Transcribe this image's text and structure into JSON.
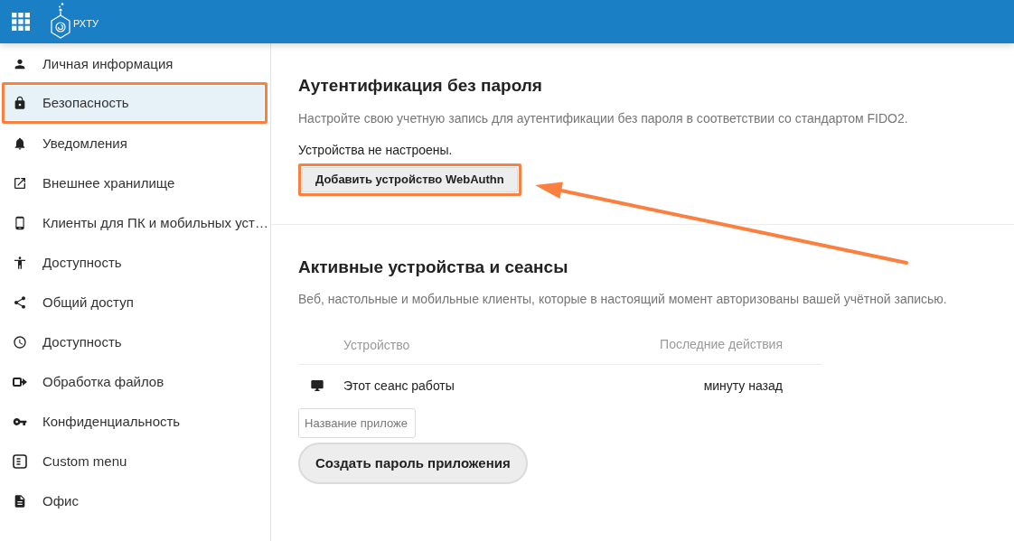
{
  "header": {
    "logo_text": "РХТУ"
  },
  "sidebar": {
    "items": [
      {
        "label": "Личная информация",
        "selected": false,
        "highlighted": false
      },
      {
        "label": "Безопасность",
        "selected": true,
        "highlighted": true
      },
      {
        "label": "Уведомления",
        "selected": false,
        "highlighted": false
      },
      {
        "label": "Внешнее хранилище",
        "selected": false,
        "highlighted": false
      },
      {
        "label": "Клиенты для ПК и мобильных уст…",
        "selected": false,
        "highlighted": false
      },
      {
        "label": "Доступность",
        "selected": false,
        "highlighted": false
      },
      {
        "label": "Общий доступ",
        "selected": false,
        "highlighted": false
      },
      {
        "label": "Доступность",
        "selected": false,
        "highlighted": false
      },
      {
        "label": "Обработка файлов",
        "selected": false,
        "highlighted": false
      },
      {
        "label": "Конфиденциальность",
        "selected": false,
        "highlighted": false
      },
      {
        "label": "Custom menu",
        "selected": false,
        "highlighted": false
      },
      {
        "label": "Офис",
        "selected": false,
        "highlighted": false
      }
    ]
  },
  "passwordless": {
    "title": "Аутентификация без пароля",
    "description": "Настройте свою учетную запись для аутентификации без пароля в соответствии со стандартом FIDO2.",
    "status": "Устройства не настроены.",
    "add_button": {
      "label": "Добавить устройство WebAuthn",
      "highlighted": true
    }
  },
  "sessions": {
    "title": "Активные устройства и сеансы",
    "description": "Веб, настольные и мобильные клиенты, которые в настоящий момент авторизованы вашей учётной записью.",
    "table": {
      "columns": [
        "Устройство",
        "Последние действия"
      ],
      "rows": [
        {
          "device": "Этот сеанс работы",
          "last_activity": "минуту назад"
        }
      ]
    },
    "app_name_field": {
      "placeholder": "Название приложе"
    },
    "create_button": {
      "label": "Создать пароль приложения"
    }
  },
  "annotations": [
    {
      "kind": "arrow"
    }
  ]
}
